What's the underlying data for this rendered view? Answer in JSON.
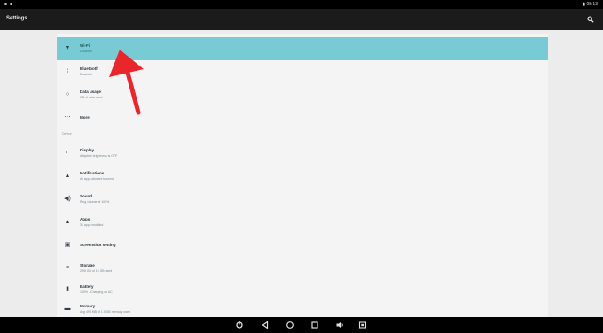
{
  "app": {
    "title": "Settings"
  },
  "status": {
    "time": "08:13"
  },
  "settings": {
    "wireless_items": [
      {
        "icon": "wifi-icon",
        "title": "Wi-Fi",
        "subtitle": "Disabled"
      },
      {
        "icon": "bluetooth-icon",
        "title": "Bluetooth",
        "subtitle": "Disabled"
      },
      {
        "icon": "data-usage-icon",
        "title": "Data usage",
        "subtitle": "0 B of data used"
      },
      {
        "icon": "more-icon",
        "title": "More",
        "subtitle": ""
      }
    ],
    "device_label": "Device",
    "device_items": [
      {
        "icon": "display-icon",
        "title": "Display",
        "subtitle": "Adaptive brightness is OFF"
      },
      {
        "icon": "notifications-icon",
        "title": "Notifications",
        "subtitle": "All apps allowed to send"
      },
      {
        "icon": "sound-icon",
        "title": "Sound",
        "subtitle": "Ring volume at 100%"
      },
      {
        "icon": "apps-icon",
        "title": "Apps",
        "subtitle": "31 apps installed"
      },
      {
        "icon": "screenshot-icon",
        "title": "Screenshot setting",
        "subtitle": ""
      },
      {
        "icon": "storage-icon",
        "title": "Storage",
        "subtitle": "2.95 GB of 16 GB used"
      },
      {
        "icon": "battery-icon",
        "title": "Battery",
        "subtitle": "100% - Charging on AC"
      },
      {
        "icon": "memory-icon",
        "title": "Memory",
        "subtitle": "Avg 493 MB of 1.9 GB memory used"
      }
    ]
  },
  "colors": {
    "selected_row": "#78cbd4",
    "arrow": "#e8262b",
    "background": "#ececec"
  }
}
